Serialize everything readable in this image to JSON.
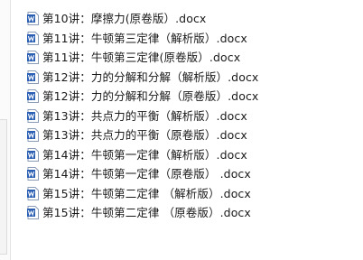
{
  "files": [
    {
      "name": "第10讲：摩擦力(原卷版）.docx",
      "icon": "word-doc-icon"
    },
    {
      "name": "第11讲：牛顿第三定律（解析版）.docx",
      "icon": "word-doc-icon"
    },
    {
      "name": "第11讲：牛顿第三定律(原卷版）.docx",
      "icon": "word-doc-icon"
    },
    {
      "name": "第12讲：力的分解和分解（解析版）.docx",
      "icon": "word-doc-icon"
    },
    {
      "name": "第12讲：力的分解和分解（原卷版）.docx",
      "icon": "word-doc-icon"
    },
    {
      "name": "第13讲：共点力的平衡（解析版）.docx",
      "icon": "word-doc-icon"
    },
    {
      "name": "第13讲：共点力的平衡（原卷版）.docx",
      "icon": "word-doc-icon"
    },
    {
      "name": "第14讲：牛顿第一定律（解析版）.docx",
      "icon": "word-doc-icon"
    },
    {
      "name": "第14讲：牛顿第一定律（原卷版） .docx",
      "icon": "word-doc-icon"
    },
    {
      "name": "第15讲：牛顿第二定律 （解析版）.docx",
      "icon": "word-doc-icon"
    },
    {
      "name": "第15讲：牛顿第二定律 （原卷版）.docx",
      "icon": "word-doc-icon"
    }
  ],
  "colors": {
    "icon_blue": "#2b5fb3",
    "text": "#1a1a1a"
  }
}
